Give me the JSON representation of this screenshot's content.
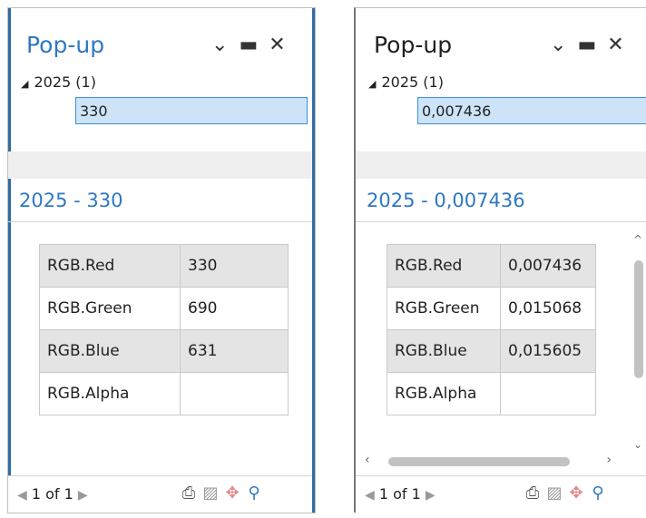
{
  "panels": [
    {
      "title": "Pop-up",
      "group_label": "2025 (1)",
      "selected_value": "330",
      "feature_title": "2025 - 330",
      "attributes": [
        {
          "key": "RGB.Red",
          "value": "330"
        },
        {
          "key": "RGB.Green",
          "value": "690"
        },
        {
          "key": "RGB.Blue",
          "value": "631"
        },
        {
          "key": "RGB.Alpha",
          "value": ""
        }
      ],
      "pager": "1 of 1"
    },
    {
      "title": "Pop-up",
      "group_label": "2025 (1)",
      "selected_value": "0,007436",
      "feature_title": "2025 - 0,007436",
      "attributes": [
        {
          "key": "RGB.Red",
          "value": "0,007436"
        },
        {
          "key": "RGB.Green",
          "value": "0,015068"
        },
        {
          "key": "RGB.Blue",
          "value": "0,015605"
        },
        {
          "key": "RGB.Alpha",
          "value": ""
        }
      ],
      "pager": "1 of 1"
    }
  ],
  "icons": {
    "dropdown": "chevron-down-icon",
    "maximize": "maximize-icon",
    "close": "close-icon",
    "expand": "tree-expand-icon",
    "prev": "previous-arrow-icon",
    "next": "next-arrow-icon",
    "print": "print-icon",
    "flash": "flash-feature-icon",
    "pan": "pan-to-icon",
    "zoom": "zoom-to-icon"
  },
  "colors": {
    "accent": "#2e78c2",
    "selection_fill": "#cde3f7",
    "selection_border": "#3d8fd6",
    "row_shade": "#e4e4e4"
  }
}
